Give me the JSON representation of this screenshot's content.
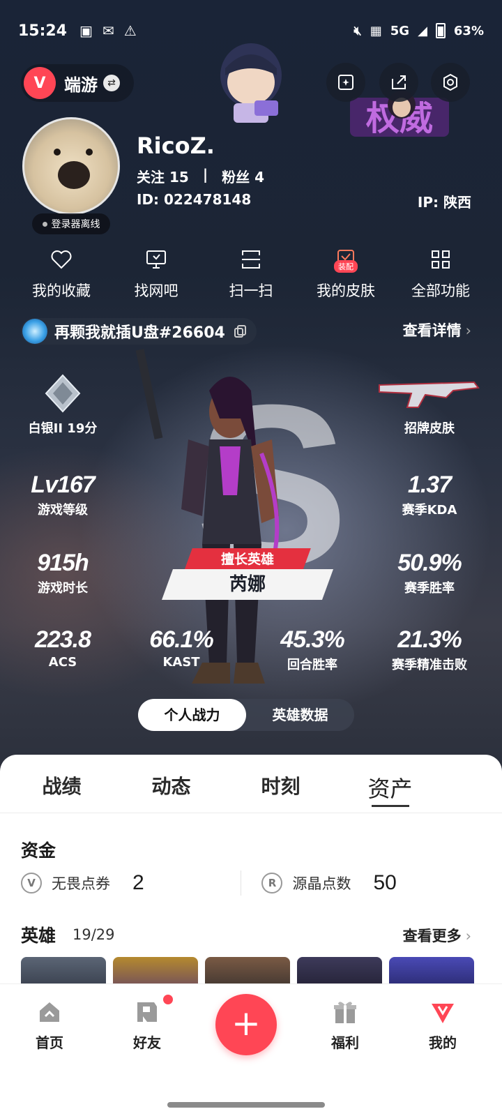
{
  "status_bar": {
    "time": "15:24",
    "network": "5G",
    "battery": "63%"
  },
  "header": {
    "game_logo": "V",
    "game_name": "端游",
    "buttons": [
      "edit-icon",
      "share-icon",
      "settings-icon"
    ],
    "sticker_text": "权威"
  },
  "profile": {
    "username": "RicoZ.",
    "follow_label": "关注",
    "follow_count": "15",
    "fans_label": "粉丝",
    "fans_count": "4",
    "id_label": "ID:",
    "id_value": "022478148",
    "ip_label": "IP:",
    "ip_value": "陕西",
    "login_status": "登录器离线"
  },
  "quick_actions": [
    {
      "label": "我的收藏",
      "icon": "heart-icon"
    },
    {
      "label": "找网吧",
      "icon": "monitor-icon"
    },
    {
      "label": "扫一扫",
      "icon": "scan-icon"
    },
    {
      "label": "我的皮肤",
      "icon": "skin-icon",
      "tag": "装配"
    },
    {
      "label": "全部功能",
      "icon": "grid-icon"
    }
  ],
  "riot_id": {
    "name": "再颗我就插U盘#26604",
    "details_label": "查看详情"
  },
  "stats": {
    "rank": "白银II 19分",
    "skin_label": "招牌皮肤",
    "level_value": "Lv167",
    "level_label": "游戏等级",
    "kda_value": "1.37",
    "kda_label": "赛季KDA",
    "hours_value": "915h",
    "hours_label": "游戏时长",
    "winrate_value": "50.9%",
    "winrate_label": "赛季胜率",
    "acs_value": "223.8",
    "acs_label": "ACS",
    "kast_value": "66.1%",
    "kast_label": "KAST",
    "round_value": "45.3%",
    "round_label": "回合胜率",
    "precise_value": "21.3%",
    "precise_label": "赛季精准击败",
    "best_hero_tag": "擅长英雄",
    "best_hero_name": "芮娜"
  },
  "toggle": {
    "personal": "个人战力",
    "hero_data": "英雄数据"
  },
  "tabs": [
    "战绩",
    "动态",
    "时刻",
    "资产"
  ],
  "assets": {
    "funds_title": "资金",
    "vp_label": "无畏点券",
    "vp_value": "2",
    "rp_label": "源晶点数",
    "rp_value": "50",
    "heroes_title": "英雄",
    "heroes_count": "19/29",
    "more_label": "查看更多"
  },
  "nav": {
    "home": "首页",
    "friends": "好友",
    "plus": "+",
    "welfare": "福利",
    "mine": "我的"
  },
  "colors": {
    "accent": "#ff4655"
  }
}
